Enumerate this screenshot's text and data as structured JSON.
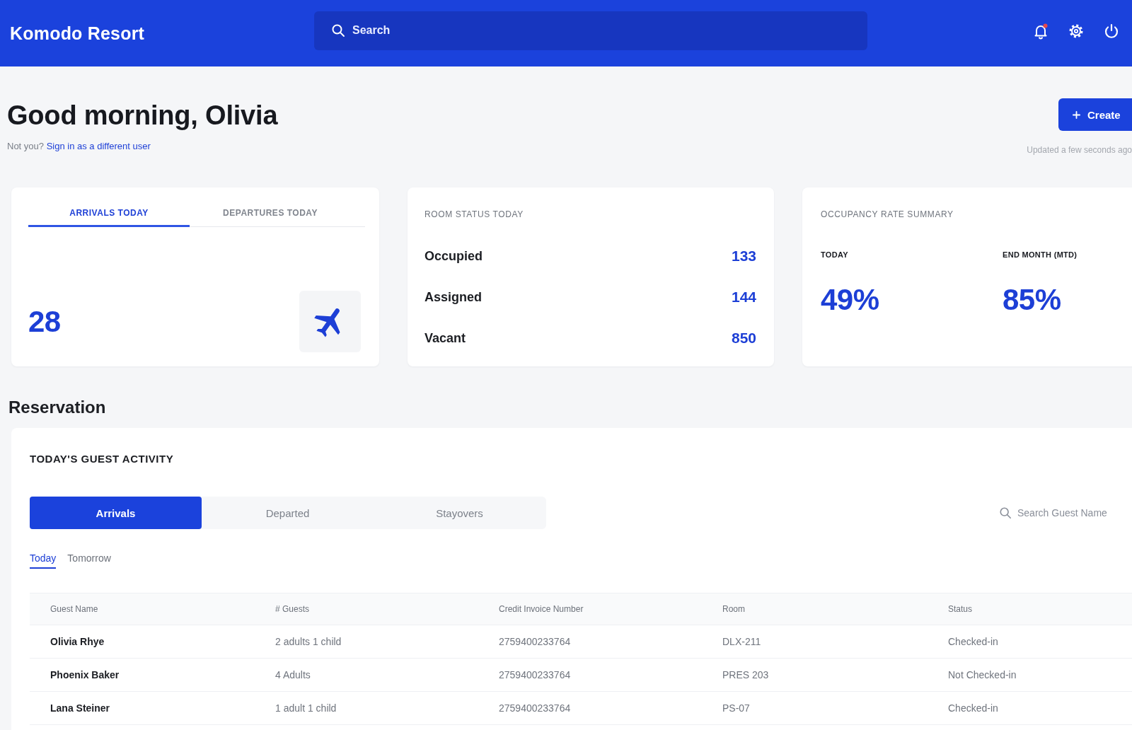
{
  "header": {
    "logo": "Komodo Resort",
    "search": {
      "placeholder": "Search"
    }
  },
  "greeting": {
    "title": "Good morning, Olivia",
    "prompt": "Not you?",
    "link": "Sign in as a different user",
    "updated": "Updated a few seconds ago"
  },
  "create_button": {
    "label": "Create"
  },
  "arrivals_card": {
    "tabs": [
      {
        "label": "ARRIVALS TODAY",
        "selected": true
      },
      {
        "label": "DEPARTURES TODAY",
        "selected": false
      }
    ],
    "count": "28"
  },
  "room_status": {
    "title": "ROOM STATUS TODAY",
    "rows": [
      {
        "label": "Occupied",
        "value": "133"
      },
      {
        "label": "Assigned",
        "value": "144"
      },
      {
        "label": "Vacant",
        "value": "850"
      }
    ]
  },
  "occupancy": {
    "title": "OCCUPANCY RATE SUMMARY",
    "stats": [
      {
        "label": "TODAY",
        "value": "49%"
      },
      {
        "label": "END MONTH (MTD)",
        "value": "85%"
      }
    ]
  },
  "reservation": {
    "heading": "Reservation",
    "title": "TODAY'S GUEST ACTIVITY",
    "segments": [
      {
        "label": "Arrivals",
        "selected": true
      },
      {
        "label": "Departed",
        "selected": false
      },
      {
        "label": "Stayovers",
        "selected": false
      }
    ],
    "search": {
      "placeholder": "Search Guest Name"
    },
    "day_tabs": [
      {
        "label": "Today",
        "selected": true
      },
      {
        "label": "Tomorrow",
        "selected": false
      }
    ],
    "table": {
      "columns": [
        "Guest Name",
        "# Guests",
        "Credit Invoice Number",
        "Room",
        "Status"
      ],
      "rows": [
        [
          "Olivia Rhye",
          "2 adults 1 child",
          "2759400233764",
          "DLX-211",
          "Checked-in"
        ],
        [
          "Phoenix Baker",
          "4 Adults",
          "2759400233764",
          "PRES 203",
          "Not Checked-in"
        ],
        [
          "Lana Steiner",
          "1 adult 1 child",
          "2759400233764",
          "PS-07",
          "Checked-in"
        ]
      ]
    }
  }
}
